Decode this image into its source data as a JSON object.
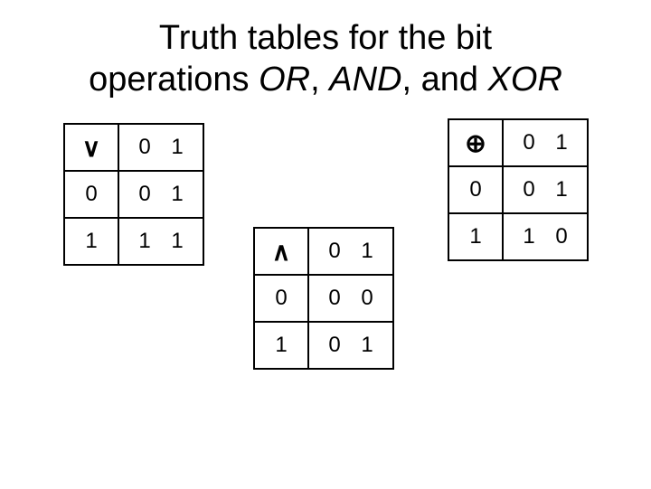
{
  "title_parts": {
    "t1": "Truth tables for the bit",
    "t2": "operations ",
    "op1": "OR",
    "sep1": ", ",
    "op2": "AND",
    "sep2": ", and ",
    "op3": "XOR"
  },
  "tables": {
    "or": {
      "symbol": "∨",
      "col0": "0",
      "col1": "1",
      "row0": "0",
      "row1": "1",
      "c00": "0",
      "c01": "1",
      "c10": "1",
      "c11": "1"
    },
    "and": {
      "symbol": "∧",
      "col0": "0",
      "col1": "1",
      "row0": "0",
      "row1": "1",
      "c00": "0",
      "c01": "0",
      "c10": "0",
      "c11": "1"
    },
    "xor": {
      "symbol": "⊕",
      "col0": "0",
      "col1": "1",
      "row0": "0",
      "row1": "1",
      "c00": "0",
      "c01": "1",
      "c10": "1",
      "c11": "0"
    }
  }
}
